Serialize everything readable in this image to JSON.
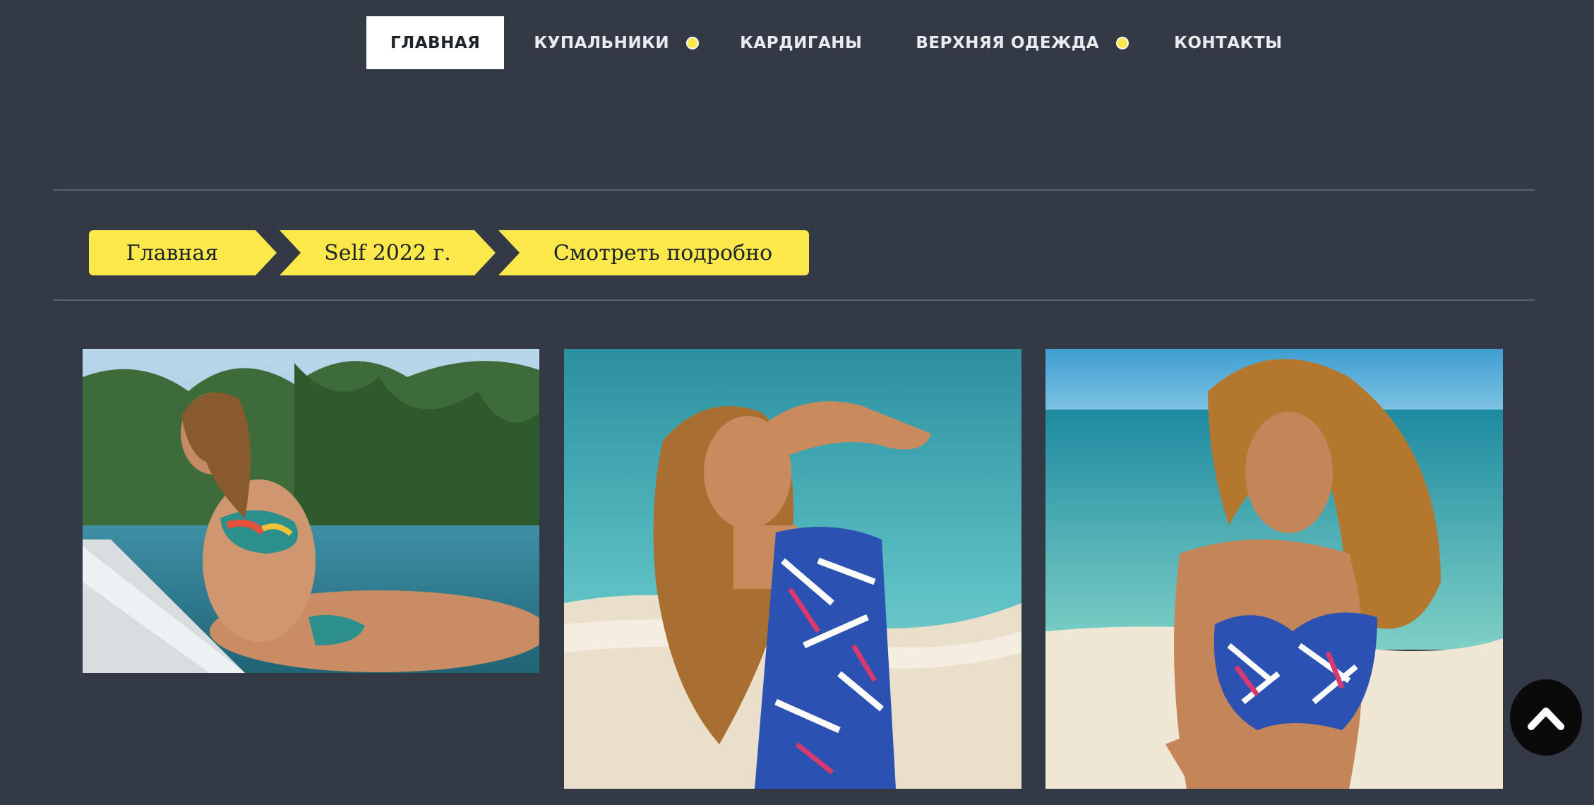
{
  "nav": {
    "items": [
      {
        "label": "ГЛАВНАЯ",
        "active": true
      },
      {
        "label": "КУПАЛЬНИКИ",
        "has_submenu": true
      },
      {
        "label": "КАРДИГАНЫ"
      },
      {
        "label": "ВЕРХНЯЯ ОДЕЖДА",
        "has_submenu": true
      },
      {
        "label": "КОНТАКТЫ"
      }
    ],
    "submenu_indicator_icon": "dot-icon"
  },
  "breadcrumb": {
    "items": [
      {
        "label": "Главная"
      },
      {
        "label": "Self 2022 г."
      },
      {
        "label": "Смотреть подробно"
      }
    ]
  },
  "gallery": {
    "photos": [
      {
        "subject": "model in floral bikini on sun lounger by pool with palms"
      },
      {
        "subject": "model in blue leaf-print one-piece swimsuit on beach"
      },
      {
        "subject": "model in blue leaf-print bikini top on beach"
      }
    ]
  },
  "scroll_top": {
    "icon": "chevron-up-icon"
  },
  "colors": {
    "background": "#343a45",
    "accent_yellow": "#fbe84a",
    "nav_text": "#e8ebef",
    "active_bg": "#ffffff",
    "scroll_button": "#0a0a0a"
  }
}
